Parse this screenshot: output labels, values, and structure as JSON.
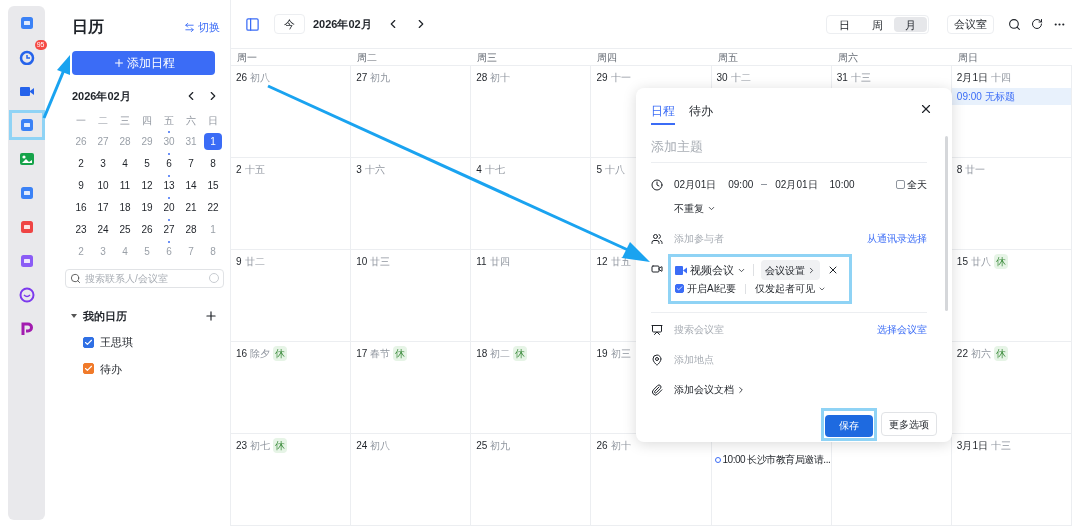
{
  "rail": [
    {
      "selected": false
    },
    {
      "selected": false,
      "badge": "95"
    },
    {
      "selected": false
    },
    {
      "selected": true
    },
    {
      "selected": false
    },
    {
      "selected": false
    },
    {
      "selected": false
    },
    {
      "selected": false
    },
    {
      "selected": false
    },
    {
      "selected": false
    }
  ],
  "sidebar": {
    "title": "日历",
    "switch": "切换",
    "add_button": "添加日程",
    "mini_calendar": {
      "month": "2026年02月",
      "weekdays": [
        "一",
        "二",
        "三",
        "四",
        "五",
        "六",
        "日"
      ],
      "days": [
        {
          "text": "26",
          "muted": true,
          "selected": false,
          "dot": false
        },
        {
          "text": "27",
          "muted": true,
          "selected": false,
          "dot": false
        },
        {
          "text": "28",
          "muted": true,
          "selected": false,
          "dot": false
        },
        {
          "text": "29",
          "muted": true,
          "selected": false,
          "dot": false
        },
        {
          "text": "30",
          "muted": true,
          "selected": false,
          "dot": true
        },
        {
          "text": "31",
          "muted": true,
          "selected": false,
          "dot": false
        },
        {
          "text": "1",
          "muted": false,
          "selected": true,
          "dot": false
        },
        {
          "text": "2",
          "muted": false,
          "selected": false,
          "dot": false
        },
        {
          "text": "3",
          "muted": false,
          "selected": false,
          "dot": false
        },
        {
          "text": "4",
          "muted": false,
          "selected": false,
          "dot": false
        },
        {
          "text": "5",
          "muted": false,
          "selected": false,
          "dot": false
        },
        {
          "text": "6",
          "muted": false,
          "selected": false,
          "dot": true
        },
        {
          "text": "7",
          "muted": false,
          "selected": false,
          "dot": false
        },
        {
          "text": "8",
          "muted": false,
          "selected": false,
          "dot": false
        },
        {
          "text": "9",
          "muted": false,
          "selected": false,
          "dot": false
        },
        {
          "text": "10",
          "muted": false,
          "selected": false,
          "dot": false
        },
        {
          "text": "11",
          "muted": false,
          "selected": false,
          "dot": false
        },
        {
          "text": "12",
          "muted": false,
          "selected": false,
          "dot": false
        },
        {
          "text": "13",
          "muted": false,
          "selected": false,
          "dot": true
        },
        {
          "text": "14",
          "muted": false,
          "selected": false,
          "dot": false
        },
        {
          "text": "15",
          "muted": false,
          "selected": false,
          "dot": false
        },
        {
          "text": "16",
          "muted": false,
          "selected": false,
          "dot": false
        },
        {
          "text": "17",
          "muted": false,
          "selected": false,
          "dot": false
        },
        {
          "text": "18",
          "muted": false,
          "selected": false,
          "dot": false
        },
        {
          "text": "19",
          "muted": false,
          "selected": false,
          "dot": false
        },
        {
          "text": "20",
          "muted": false,
          "selected": false,
          "dot": true
        },
        {
          "text": "21",
          "muted": false,
          "selected": false,
          "dot": false
        },
        {
          "text": "22",
          "muted": false,
          "selected": false,
          "dot": false
        },
        {
          "text": "23",
          "muted": false,
          "selected": false,
          "dot": false
        },
        {
          "text": "24",
          "muted": false,
          "selected": false,
          "dot": false
        },
        {
          "text": "25",
          "muted": false,
          "selected": false,
          "dot": false
        },
        {
          "text": "26",
          "muted": false,
          "selected": false,
          "dot": false
        },
        {
          "text": "27",
          "muted": false,
          "selected": false,
          "dot": true
        },
        {
          "text": "28",
          "muted": false,
          "selected": false,
          "dot": false
        },
        {
          "text": "1",
          "muted": true,
          "selected": false,
          "dot": false
        },
        {
          "text": "2",
          "muted": true,
          "selected": false,
          "dot": false
        },
        {
          "text": "3",
          "muted": true,
          "selected": false,
          "dot": false
        },
        {
          "text": "4",
          "muted": true,
          "selected": false,
          "dot": false
        },
        {
          "text": "5",
          "muted": true,
          "selected": false,
          "dot": false
        },
        {
          "text": "6",
          "muted": true,
          "selected": false,
          "dot": true
        },
        {
          "text": "7",
          "muted": true,
          "selected": false,
          "dot": false
        },
        {
          "text": "8",
          "muted": true,
          "selected": false,
          "dot": false
        }
      ]
    },
    "search": {
      "placeholder": "搜索联系人/会议室"
    },
    "my_calendars": {
      "title": "我的日历",
      "expanded": true,
      "items": [
        {
          "name": "王思琪",
          "checked": true,
          "color": "#2f6fe4"
        },
        {
          "name": "待办",
          "checked": true,
          "color": "#f07a2a"
        }
      ]
    }
  },
  "toolbar": {
    "today": "今",
    "month": "2026年02月",
    "views": [
      {
        "label": "日",
        "selected": false
      },
      {
        "label": "周",
        "selected": false
      },
      {
        "label": "月",
        "selected": true
      }
    ],
    "room": "会议室"
  },
  "grid": {
    "weekdays": [
      "周一",
      "周二",
      "周三",
      "周四",
      "周五",
      "周六",
      "周日"
    ],
    "cells": [
      {
        "date": "26",
        "lunar": "初八"
      },
      {
        "date": "27",
        "lunar": "初九"
      },
      {
        "date": "28",
        "lunar": "初十"
      },
      {
        "date": "29",
        "lunar": "十一"
      },
      {
        "date": "30",
        "lunar": "十二"
      },
      {
        "date": "31",
        "lunar": "十三"
      },
      {
        "date": "2月1日",
        "lunar": "十四",
        "events": [
          {
            "kind": "block",
            "text": "09:00 无标题"
          }
        ]
      },
      {
        "date": "2",
        "lunar": "十五"
      },
      {
        "date": "3",
        "lunar": "十六"
      },
      {
        "date": "4",
        "lunar": "十七"
      },
      {
        "date": "5",
        "lunar": "十八"
      },
      {},
      {},
      {
        "date": "8",
        "lunar": "廿一"
      },
      {
        "date": "9",
        "lunar": "廿二"
      },
      {
        "date": "10",
        "lunar": "廿三"
      },
      {
        "date": "11",
        "lunar": "廿四"
      },
      {
        "date": "12",
        "lunar": "廿五"
      },
      {},
      {},
      {
        "date": "15",
        "lunar": "廿八",
        "holiday": "休"
      },
      {
        "date": "16",
        "lunar": "除夕",
        "holiday": "休"
      },
      {
        "date": "17",
        "lunar": "春节",
        "holiday": "休"
      },
      {
        "date": "18",
        "lunar": "初二",
        "holiday": "休"
      },
      {
        "date": "19",
        "lunar": "初三"
      },
      {},
      {},
      {
        "date": "22",
        "lunar": "初六",
        "holiday": "休"
      },
      {
        "date": "23",
        "lunar": "初七",
        "holiday": "休"
      },
      {
        "date": "24",
        "lunar": "初八"
      },
      {
        "date": "25",
        "lunar": "初九"
      },
      {
        "date": "26",
        "lunar": "初十"
      },
      {
        "events": [
          {
            "kind": "todo",
            "text": "10:00 长沙市教育局邀请..."
          }
        ]
      },
      {},
      {
        "date": "3月1日",
        "lunar": "十三"
      }
    ]
  },
  "dialog": {
    "tabs": [
      {
        "label": "日程",
        "selected": true
      },
      {
        "label": "待办",
        "selected": false
      }
    ],
    "title_placeholder": "添加主题",
    "start_date": "02月01日",
    "start_time": "09:00",
    "end_date": "02月01日",
    "end_time": "10:00",
    "all_day": {
      "label": "全天",
      "checked": false
    },
    "repeat": "不重复",
    "attendees_placeholder": "添加参与者",
    "contacts_link": "从通讯录选择",
    "meeting": {
      "type": "视频会议",
      "settings": "会议设置",
      "ai_notes": {
        "label": "开启AI纪要",
        "checked": true
      },
      "visibility": "仅发起者可见"
    },
    "room_placeholder": "搜索会议室",
    "room_link": "选择会议室",
    "location_placeholder": "添加地点",
    "docs": "添加会议文档",
    "save": "保存",
    "more": "更多选项"
  }
}
